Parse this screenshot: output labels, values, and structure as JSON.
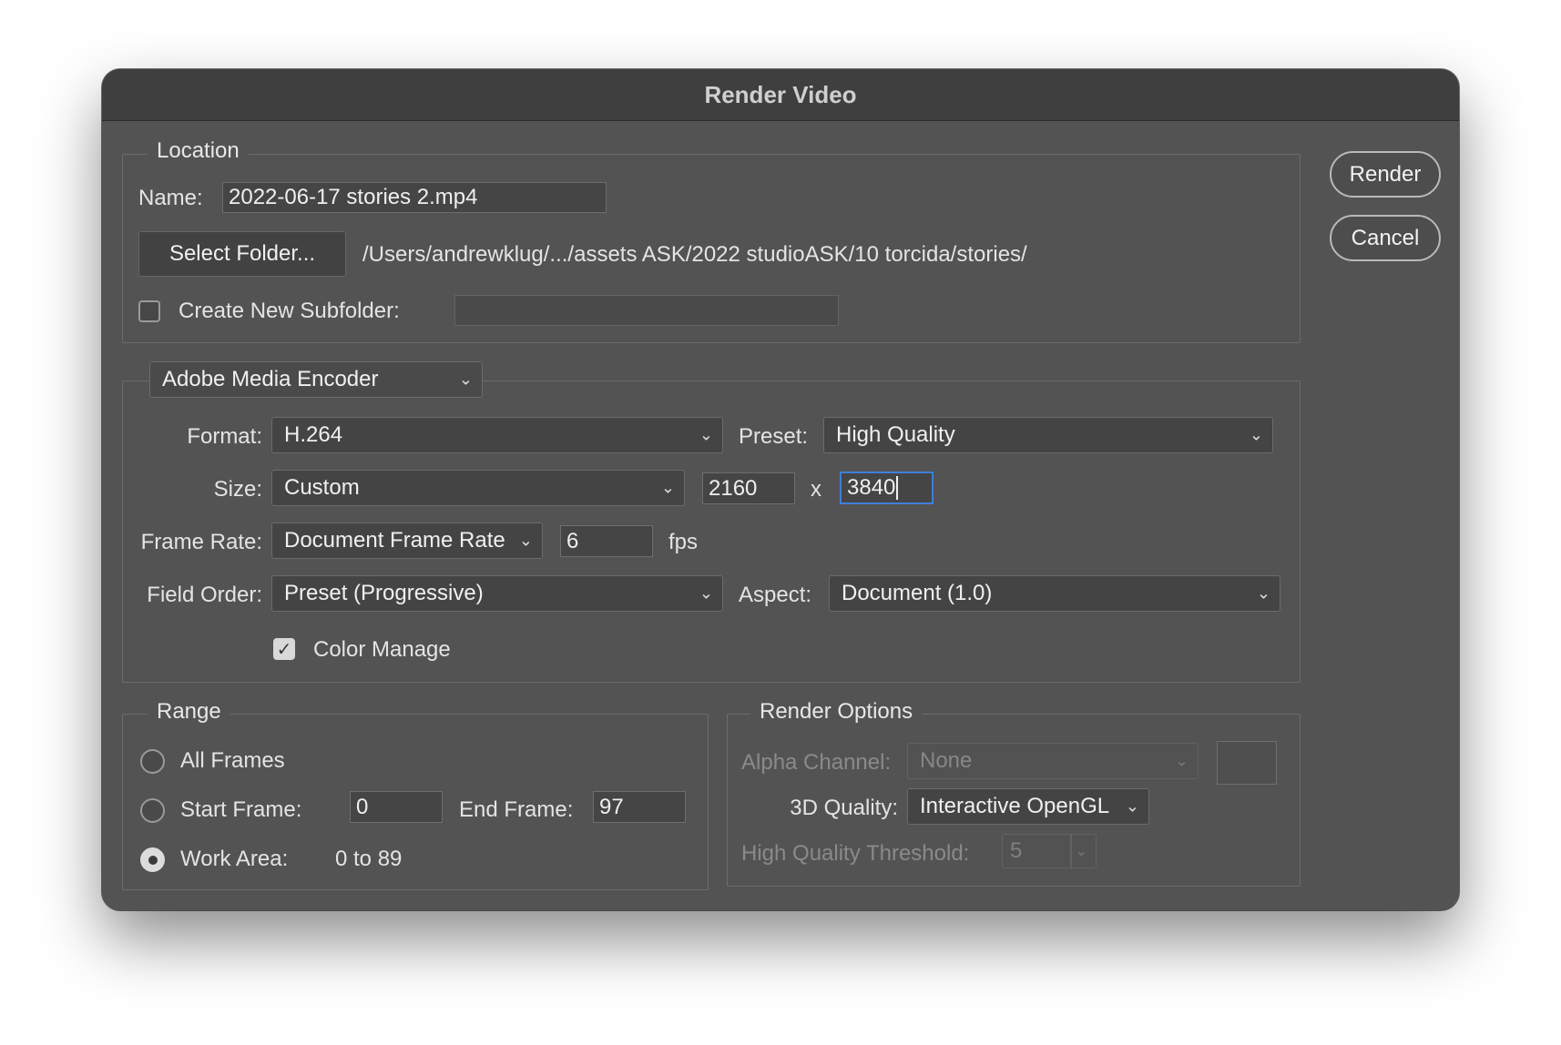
{
  "window": {
    "title": "Render Video"
  },
  "actions": {
    "render_label": "Render",
    "cancel_label": "Cancel"
  },
  "location": {
    "legend": "Location",
    "name_label": "Name:",
    "name_value": "2022-06-17 stories 2.mp4",
    "select_folder_label": "Select Folder...",
    "path": "/Users/andrewklug/.../assets ASK/2022 studioASK/10 torcida/stories/",
    "subfolder_label": "Create New Subfolder:",
    "subfolder_checked": false,
    "subfolder_value": ""
  },
  "encoder": {
    "selected": "Adobe Media Encoder",
    "format_label": "Format:",
    "format_value": "H.264",
    "preset_label": "Preset:",
    "preset_value": "High Quality",
    "size_label": "Size:",
    "size_value": "Custom",
    "width": "2160",
    "x_label": "x",
    "height": "3840",
    "frame_rate_label": "Frame Rate:",
    "frame_rate_value": "Document Frame Rate",
    "fps_value": "6",
    "fps_unit": "fps",
    "field_order_label": "Field Order:",
    "field_order_value": "Preset (Progressive)",
    "aspect_label": "Aspect:",
    "aspect_value": "Document (1.0)",
    "color_manage_label": "Color Manage",
    "color_manage_checked": true
  },
  "range": {
    "legend": "Range",
    "all_frames_label": "All Frames",
    "start_frame_label": "Start Frame:",
    "start_frame_value": "0",
    "end_frame_label": "End Frame:",
    "end_frame_value": "97",
    "work_area_label": "Work Area:",
    "work_area_value": "0 to 89",
    "selected": "Work Area"
  },
  "render_options": {
    "legend": "Render Options",
    "alpha_channel_label": "Alpha Channel:",
    "alpha_channel_value": "None",
    "quality_3d_label": "3D Quality:",
    "quality_3d_value": "Interactive OpenGL",
    "hq_threshold_label": "High Quality Threshold:",
    "hq_threshold_value": "5"
  },
  "icons": {
    "dropdown": "chevron-down-icon",
    "check": "checkmark-icon"
  }
}
